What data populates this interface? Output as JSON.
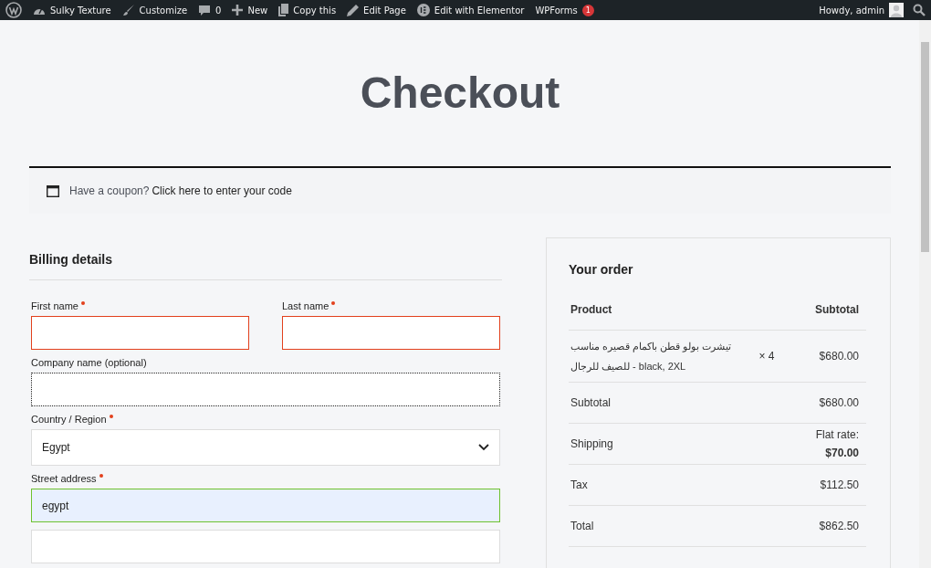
{
  "admin_bar": {
    "items": [
      {
        "kind": "wp"
      },
      {
        "kind": "dashboard",
        "label": "Sulky Texture"
      },
      {
        "kind": "brush",
        "label": "Customize"
      },
      {
        "kind": "comment",
        "label": "0"
      },
      {
        "kind": "plus",
        "label": "New"
      },
      {
        "kind": "copy",
        "label": "Copy this"
      },
      {
        "kind": "pencil",
        "label": "Edit Page"
      },
      {
        "kind": "elementor",
        "label": "Edit with Elementor"
      },
      {
        "kind": "text",
        "label": "WPForms",
        "badge": "1"
      }
    ],
    "greeting": "Howdy, admin"
  },
  "title": "Checkout",
  "coupon": {
    "text": "Have a coupon?",
    "link": "Click here to enter your code"
  },
  "billing": {
    "heading": "Billing details",
    "rows": [
      [
        {
          "label": "First name",
          "required": true,
          "error": true,
          "valid": false,
          "focused": false
        },
        {
          "label": "Last name",
          "required": true,
          "error": true,
          "valid": false,
          "focused": false
        }
      ],
      [
        {
          "label": "Company name (optional)",
          "required": false,
          "error": false,
          "valid": false,
          "focused": true
        }
      ],
      [
        {
          "label": "Country / Region",
          "required": true,
          "kind": "select",
          "value": "Egypt",
          "error": false,
          "valid": false,
          "focused": false
        }
      ],
      [
        {
          "label": "Street address",
          "required": true,
          "value": "egypt",
          "error": false,
          "valid": true,
          "focused": false
        }
      ],
      [
        {
          "error": false,
          "valid": false,
          "focused": false
        }
      ]
    ]
  },
  "order": {
    "heading": "Your order",
    "columns": [
      "Product",
      "Subtotal"
    ],
    "items": [
      {
        "name": "تيشرت بولو قطن باكمام قصيره مناسب للصيف للرجال - black, 2XL",
        "qty": "× 4",
        "subtotal": "$680.00"
      }
    ],
    "totals": [
      {
        "label": "Subtotal",
        "value": "$680.00"
      },
      {
        "label": "Shipping",
        "value": "Flat rate:",
        "amount": "$70.00"
      },
      {
        "label": "Tax",
        "value": "$112.50"
      },
      {
        "label": "Total",
        "value": "$862.50"
      }
    ]
  }
}
